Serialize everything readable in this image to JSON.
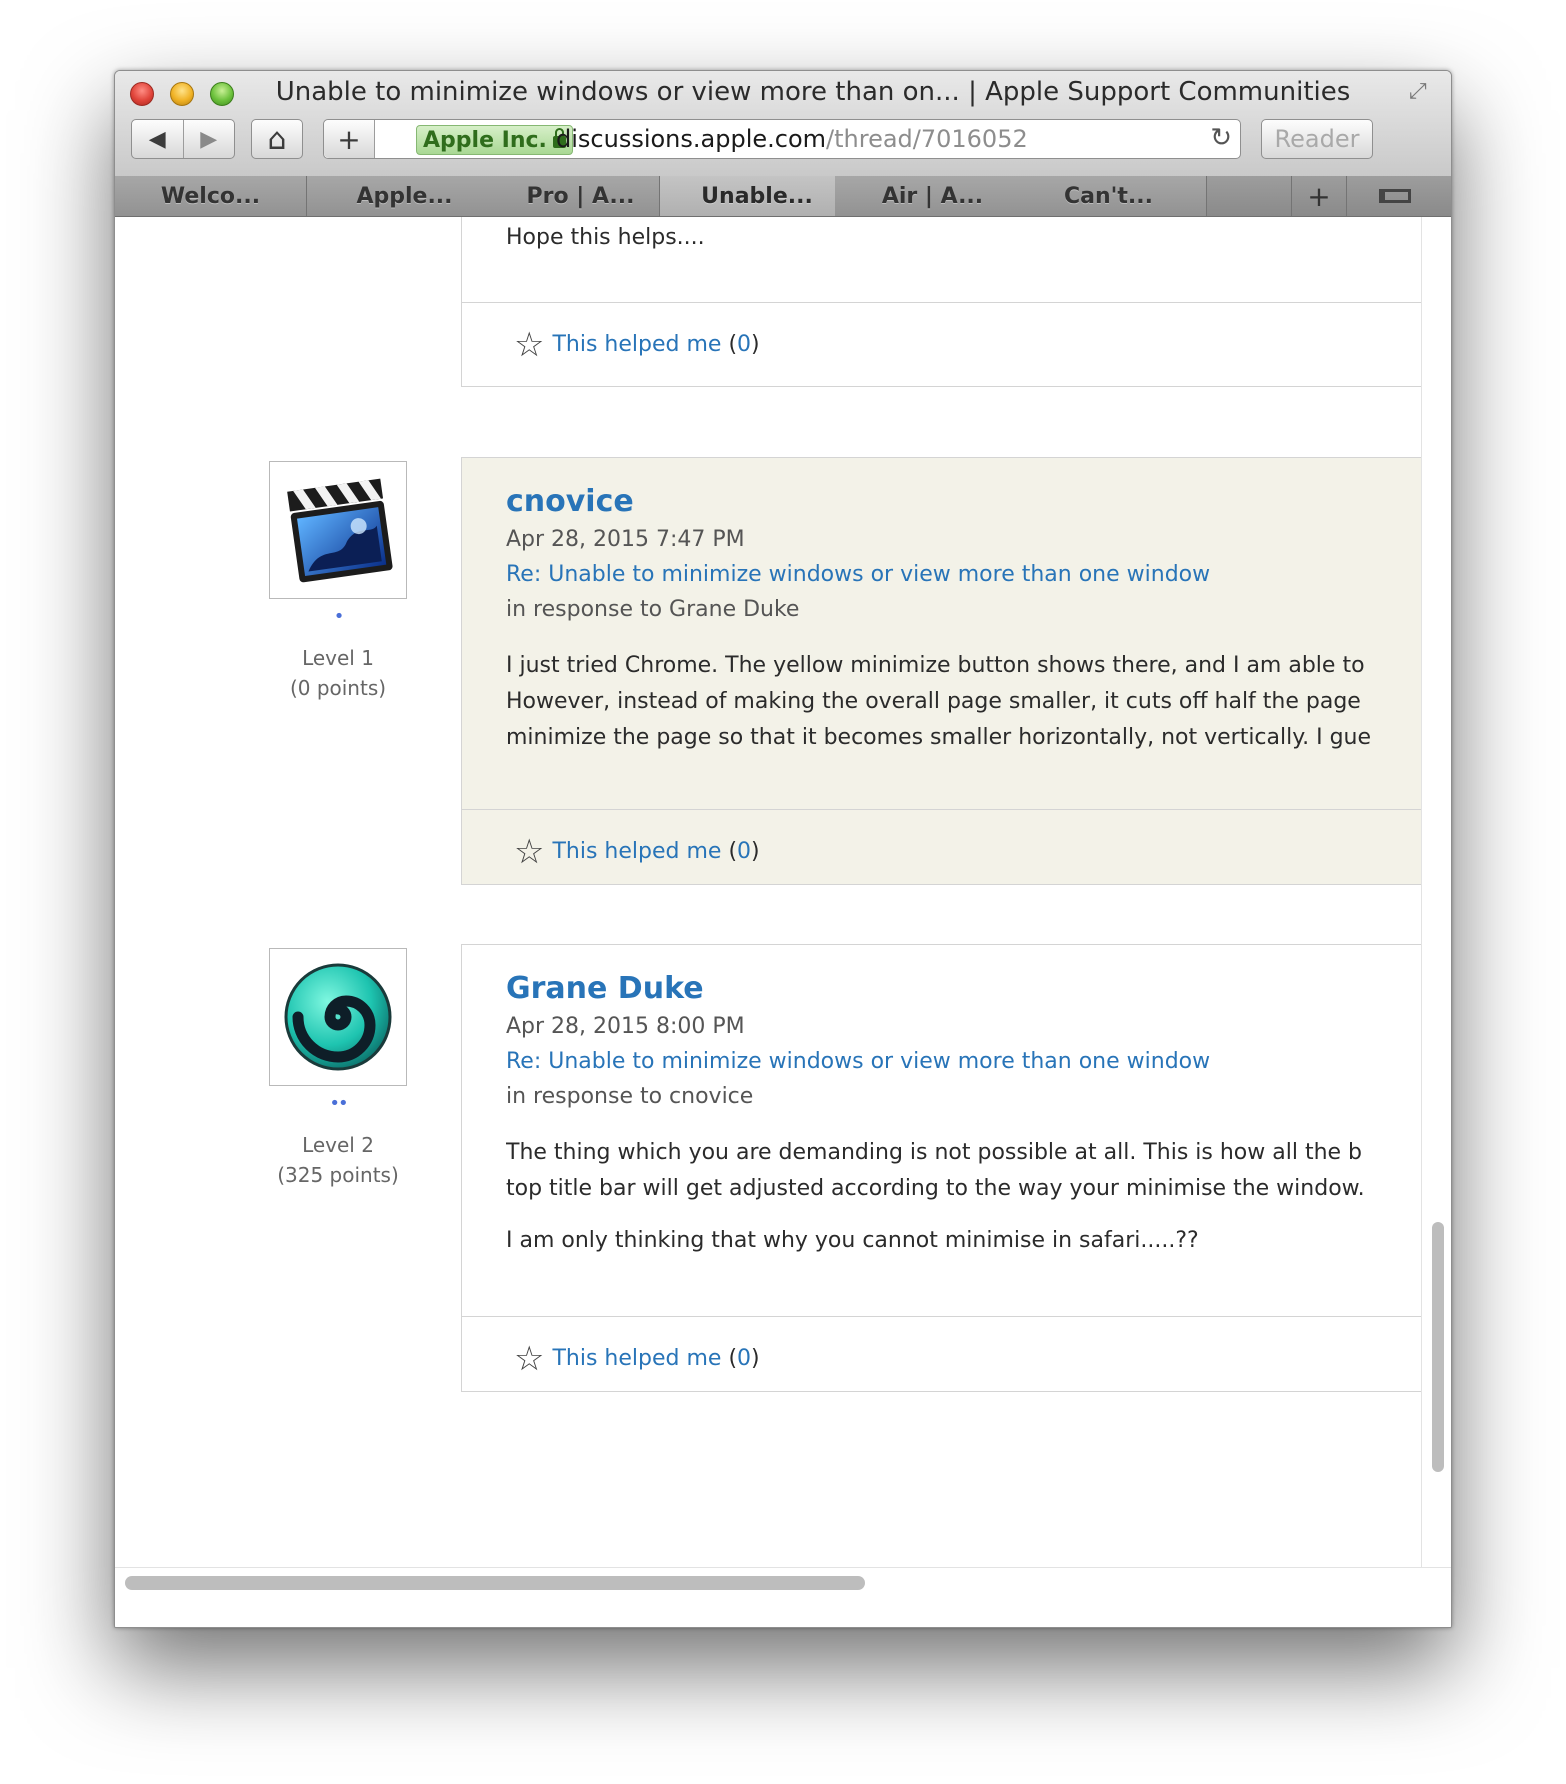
{
  "window": {
    "title": "Unable to minimize windows or view more than on... | Apple Support Communities"
  },
  "toolbar": {
    "back_glyph": "◀",
    "forward_glyph": "▶",
    "home_glyph": "⌂",
    "add_glyph": "+",
    "reload_glyph": "↻",
    "reader_label": "Reader"
  },
  "address": {
    "ev_name": "Apple Inc.",
    "host": "discussions.apple.com",
    "path": "/thread/7016052"
  },
  "tabs": [
    {
      "label": "Welco...",
      "active": false
    },
    {
      "label": "Apple...",
      "active": false
    },
    {
      "label": "Pro | A...",
      "active": false
    },
    {
      "label": "Unable...",
      "active": true
    },
    {
      "label": "Air | A...",
      "active": false
    },
    {
      "label": "Can't...",
      "active": false
    }
  ],
  "tab_add_glyph": "+",
  "posts": [
    {
      "body": [
        "Hope this helps...."
      ],
      "helped_label": "This helped me",
      "helped_count": "0"
    },
    {
      "author": "cnovice",
      "date": "Apr 28, 2015 7:47 PM",
      "subject": "Re: Unable to minimize windows or view more than one window",
      "in_response_to": "in response to Grane Duke",
      "body": [
        "I just tried Chrome. The yellow minimize button shows there, and I am able to",
        "However, instead of making the overall page smaller, it cuts off half the page",
        "minimize the page so that it becomes smaller horizontally, not vertically. I gue"
      ],
      "helped_label": "This helped me",
      "helped_count": "0",
      "level": "Level 1",
      "points": "(0 points)",
      "level_dots": "•",
      "avatar_icon": "film-clapper-icon"
    },
    {
      "author": "Grane Duke",
      "date": "Apr 28, 2015 8:00 PM",
      "subject": "Re: Unable to minimize windows or view more than one window",
      "in_response_to": "in response to cnovice",
      "body": [
        "The thing which you are demanding is not possible at all. This is how all the b",
        "top title bar will get adjusted according to the way your minimise the window."
      ],
      "body2": "I am only thinking that why you cannot minimise in safari.....??",
      "helped_label": "This helped me",
      "helped_count": "0",
      "level": "Level 2",
      "points": "(325 points)",
      "level_dots": "••",
      "avatar_icon": "swirl-icon"
    }
  ],
  "colors": {
    "link": "#2874b8",
    "shaded_post_bg": "#f3f2e8",
    "ev_badge": "#2f6d1c"
  }
}
